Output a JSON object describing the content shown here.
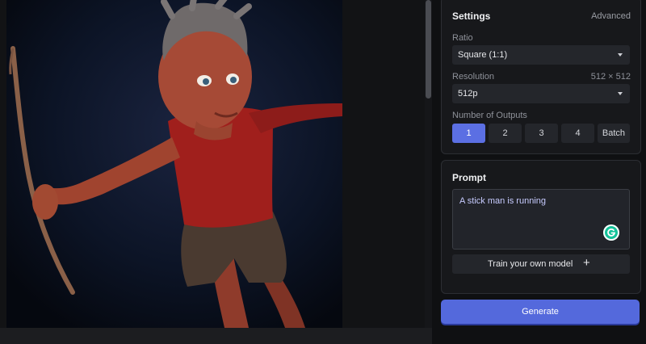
{
  "settings": {
    "title": "Settings",
    "advanced_label": "Advanced",
    "ratio_label": "Ratio",
    "ratio_value": "Square (1:1)",
    "resolution_label": "Resolution",
    "resolution_dims": "512 × 512",
    "resolution_value": "512p",
    "outputs_label": "Number of Outputs",
    "outputs_options": [
      "1",
      "2",
      "3",
      "4",
      "Batch"
    ],
    "outputs_selected": "1"
  },
  "prompt": {
    "title": "Prompt",
    "text": "A stick man is running",
    "train_label": "Train your own model",
    "train_icon": "plus-icon"
  },
  "generate_label": "Generate",
  "colors": {
    "accent": "#5469dc",
    "panel_bg": "#17181b",
    "input_bg": "#24262b"
  }
}
